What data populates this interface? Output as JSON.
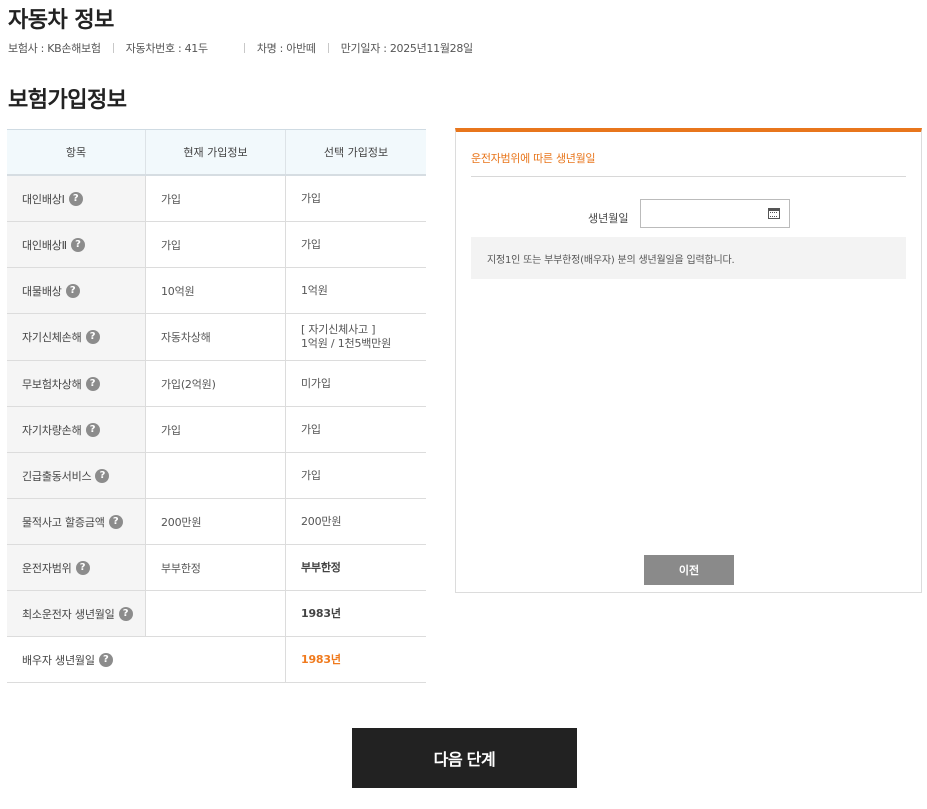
{
  "car_info": {
    "title": "자동차 정보",
    "insurer": "보험사 : KB손해보험",
    "car_number": "자동차번호 : 41두",
    "car_name": "차명 : 아반떼",
    "expiry": "만기일자 : 2025년11월28일"
  },
  "section_title": "보험가입정보",
  "table": {
    "headers": [
      "항목",
      "현재 가입정보",
      "선택 가입정보"
    ],
    "rows": [
      {
        "item": "대인배상Ⅰ",
        "current": "가입",
        "selected": "가입"
      },
      {
        "item": "대인배상Ⅱ",
        "current": "가입",
        "selected": "가입"
      },
      {
        "item": "대물배상",
        "current": "10억원",
        "selected": "1억원"
      },
      {
        "item": "자기신체손해",
        "current": "자동차상해",
        "selected_line1": "[ 자기신체사고 ]",
        "selected_line2": "1억원 / 1천5백만원"
      },
      {
        "item": "무보험차상해",
        "current": "가입(2억원)",
        "selected": "미가입"
      },
      {
        "item": "자기차량손해",
        "current": "가입",
        "selected": "가입"
      },
      {
        "item": "긴급출동서비스",
        "current": "",
        "selected": "가입"
      },
      {
        "item": "물적사고 할증금액",
        "current": "200만원",
        "selected": "200만원"
      },
      {
        "item": "운전자범위",
        "current": "부부한정",
        "selected": "부부한정"
      },
      {
        "item": "최소운전자 생년월일",
        "current": "",
        "selected": "1983년"
      },
      {
        "item": "배우자 생년월일",
        "selected": "1983년"
      }
    ],
    "help_glyph": "?"
  },
  "panel": {
    "title": "운전자범위에 따른 생년월일",
    "birth_label": "생년월일",
    "birth_value": "",
    "notice": "지정1인 또는 부부한정(배우자) 분의 생년월일을 입력합니다.",
    "prev_label": "이전"
  },
  "next_label": "다음 단계",
  "colors": {
    "accent": "#e8761c",
    "header_bg": "#f2f9fc",
    "dark_button": "#222222",
    "gray_button": "#8a8a8a"
  },
  "icons": {
    "help": "question-circle-icon",
    "calendar": "calendar-icon"
  }
}
